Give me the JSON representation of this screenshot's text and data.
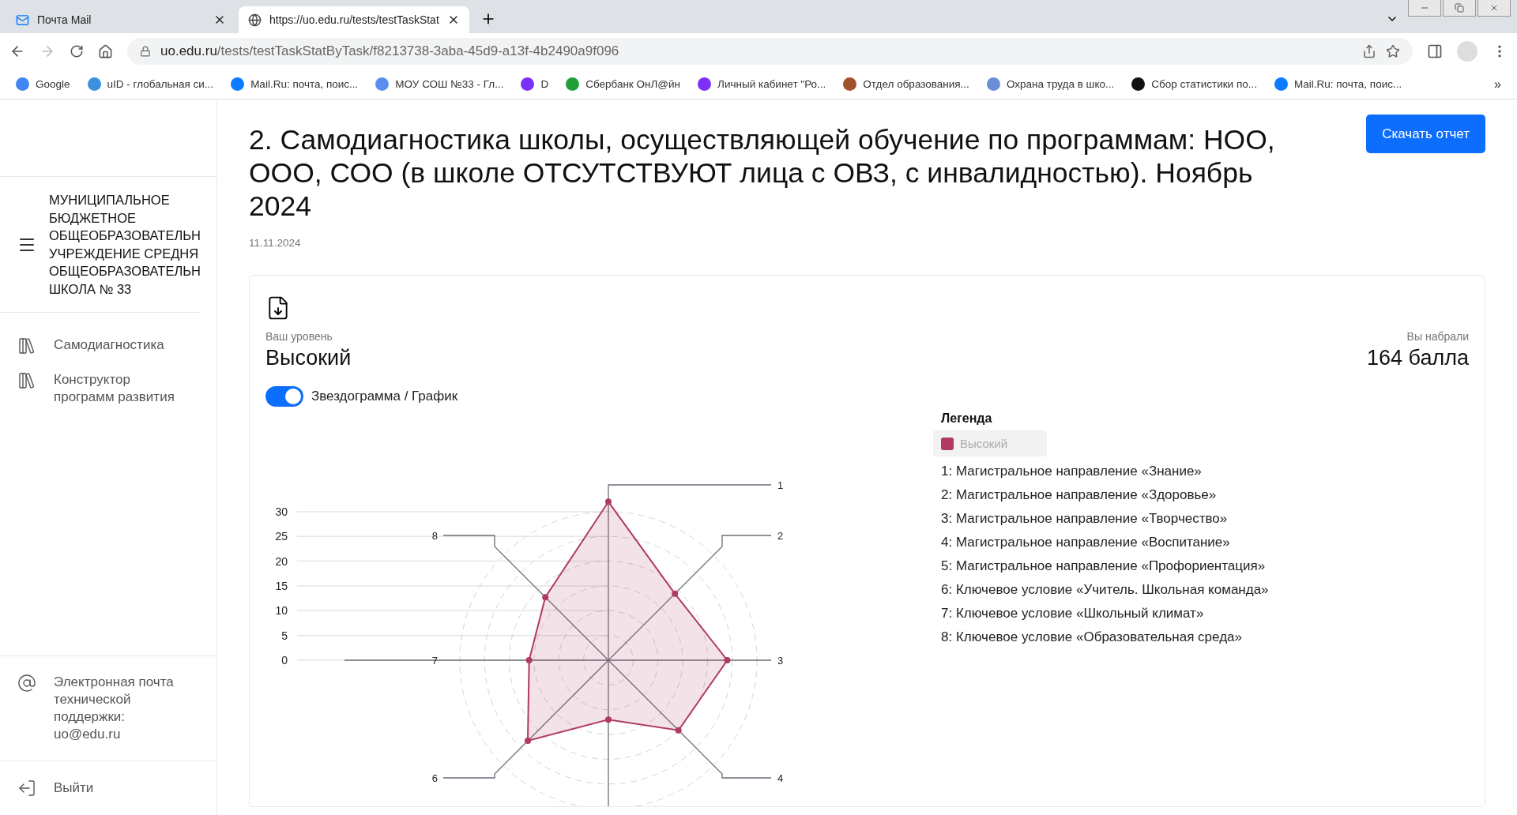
{
  "browser": {
    "tabs": [
      {
        "title": "Почта Mail",
        "selected": false
      },
      {
        "title": "https://uo.edu.ru/tests/testTaskStat",
        "selected": true
      }
    ],
    "url": {
      "domain": "uo.edu.ru",
      "path": "/tests/testTaskStatByTask/f8213738-3aba-45d9-a13f-4b2490a9f096"
    },
    "bookmarks": [
      {
        "label": "Google",
        "color": "#4285f4"
      },
      {
        "label": "uID - глобальная си...",
        "color": "#3d8fe0"
      },
      {
        "label": "Mail.Ru: почта, поис...",
        "color": "#0a7cff"
      },
      {
        "label": "МОУ СОШ №33 - Гл...",
        "color": "#5b8def"
      },
      {
        "label": "D",
        "color": "#7b2ff7"
      },
      {
        "label": "Сбербанк ОнЛ@йн",
        "color": "#21a038"
      },
      {
        "label": "Личный кабинет \"Ро...",
        "color": "#7b2ff7"
      },
      {
        "label": "Отдел образования...",
        "color": "#a0522d"
      },
      {
        "label": "Охрана труда в шко...",
        "color": "#6b8fd6"
      },
      {
        "label": "Сбор статистики по...",
        "color": "#111111"
      },
      {
        "label": "Mail.Ru: почта, поис...",
        "color": "#0a7cff"
      }
    ],
    "more": "»"
  },
  "sidebar": {
    "org": "МУНИЦИПАЛЬНОЕ\nБЮДЖЕТНОЕ\nОБЩЕОБРАЗОВАТЕЛЬН\nУЧРЕЖДЕНИЕ СРЕДНЯ\nОБЩЕОБРАЗОВАТЕЛЬН\nШКОЛА № 33",
    "items": [
      {
        "label": "Самодиагностика"
      },
      {
        "label": "Конструктор программ развития"
      }
    ],
    "support": "Электронная почта технической поддержки: uo@edu.ru",
    "logout": "Выйти"
  },
  "main": {
    "title": "2. Самодиагностика школы, осуществляющей обучение по программам: НОО, ООО, СОО (в школе ОТСУТСТВУЮТ лица с ОВЗ, с инвалидностью). Ноябрь 2024",
    "date": "11.11.2024",
    "download_button": "Скачать отчет",
    "card": {
      "level_label": "Ваш уровень",
      "level": "Высокий",
      "score_label": "Вы набрали",
      "score": "164 балла",
      "toggle": {
        "label": "Звездограмма / График",
        "on": true
      },
      "legend": {
        "title": "Легенда",
        "items": [
          "1: Магистральное направление «Знание»",
          "2: Магистральное направление «Здоровье»",
          "3: Магистральное направление «Творчество»",
          "4: Магистральное направление «Воспитание»",
          "5: Магистральное направление «Профориентация»",
          "6: Ключевое условие «Учитель. Школьная команда»",
          "7: Ключевое условие «Школьный климат»",
          "8: Ключевое условие «Образовательная среда»"
        ]
      },
      "radar": {
        "axis_labels": [
          "1",
          "8",
          "2",
          "7",
          "3",
          "6",
          "4"
        ],
        "tick_labels": [
          "30",
          "25",
          "20",
          "15",
          "10",
          "5",
          "0"
        ],
        "series": [
          {
            "name": "Высокий",
            "color": "#b03a63"
          }
        ]
      }
    }
  }
}
